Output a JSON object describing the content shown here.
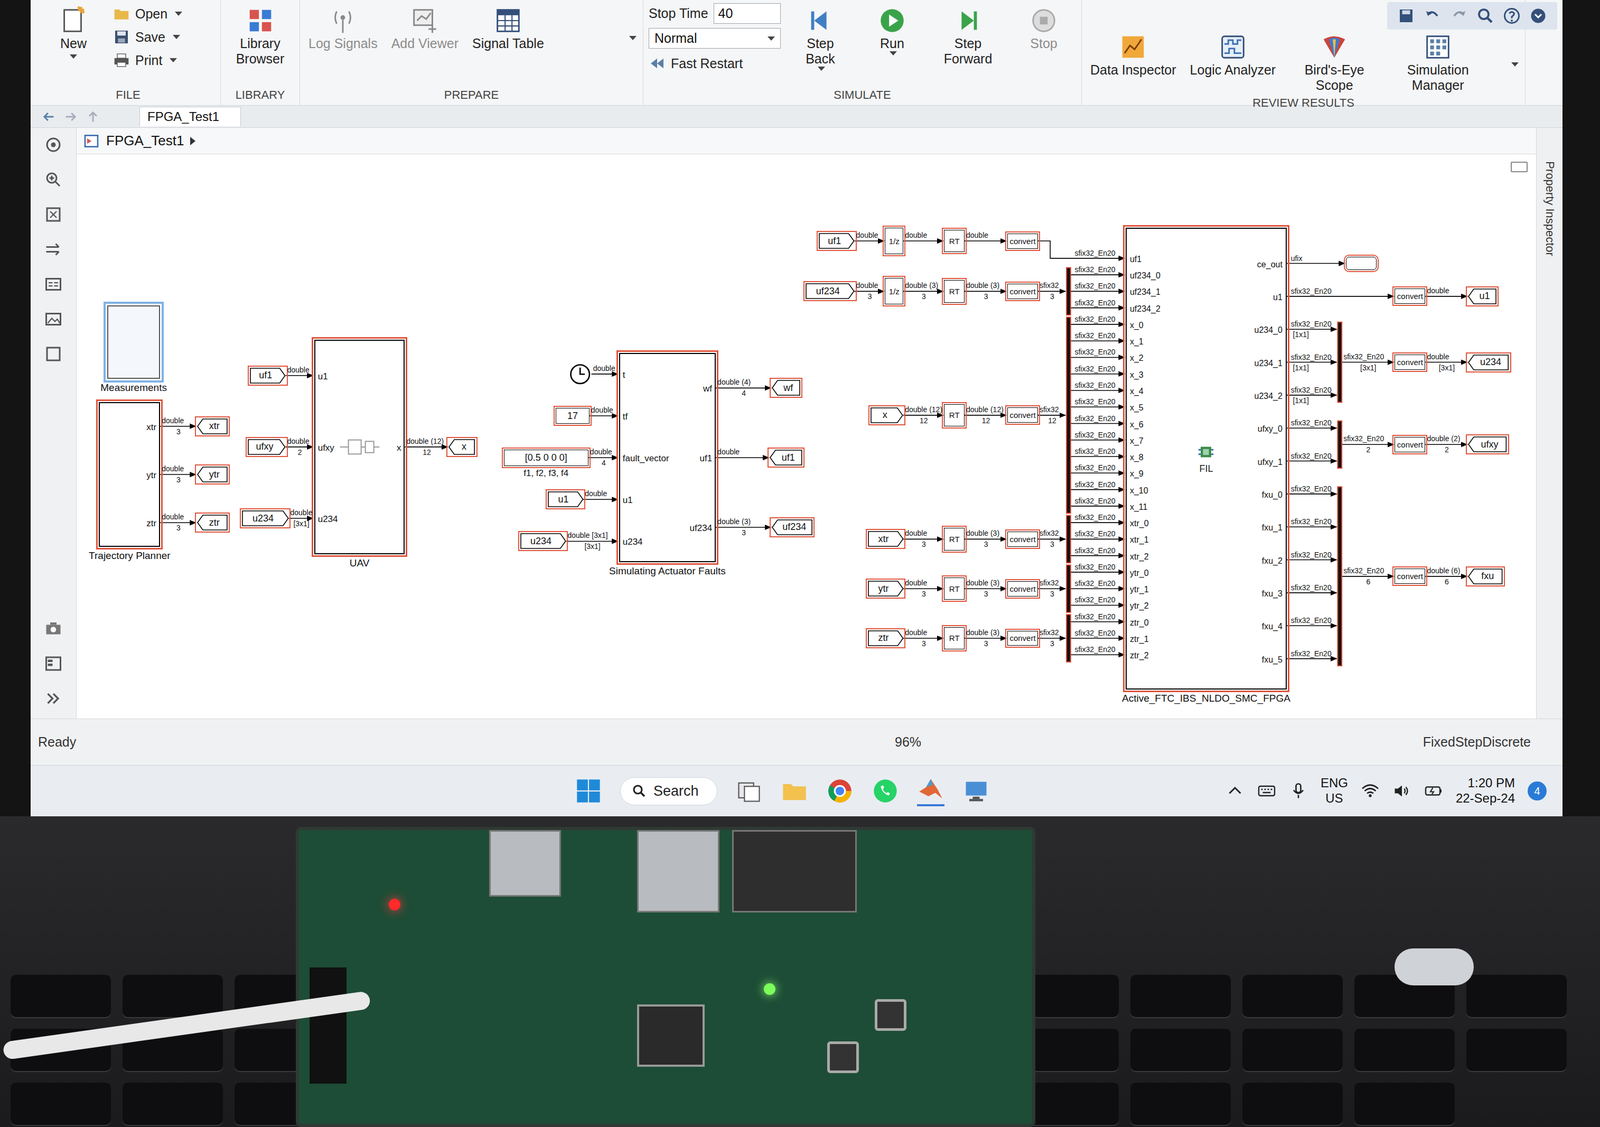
{
  "ribbon": {
    "file": {
      "group": "FILE",
      "new": "New",
      "items": [
        {
          "label": "Open"
        },
        {
          "label": "Save"
        },
        {
          "label": "Print"
        }
      ]
    },
    "library": {
      "group": "LIBRARY",
      "button": "Library Browser"
    },
    "prepare": {
      "group": "PREPARE",
      "buttons": [
        {
          "label": "Log Signals",
          "disabled": true
        },
        {
          "label": "Add Viewer",
          "disabled": true
        },
        {
          "label": "Signal Table",
          "disabled": false
        }
      ]
    },
    "simulate": {
      "group": "SIMULATE",
      "stopTimeLabel": "Stop Time",
      "stopTime": "40",
      "mode": "Normal",
      "fastRestart": "Fast Restart",
      "buttons": [
        {
          "label": "Step Back",
          "disabled": false
        },
        {
          "label": "Run",
          "disabled": false
        },
        {
          "label": "Step Forward",
          "disabled": false
        },
        {
          "label": "Stop",
          "disabled": true
        }
      ]
    },
    "review": {
      "group": "REVIEW RESULTS",
      "buttons": [
        {
          "label": "Data Inspector"
        },
        {
          "label": "Logic Analyzer"
        },
        {
          "label": "Bird's-Eye Scope"
        },
        {
          "label": "Simulation Manager"
        }
      ]
    }
  },
  "tab": "FPGA_Test1",
  "breadcrumb": "FPGA_Test1",
  "propertyInspector": "Property Inspector",
  "status": {
    "left": "Ready",
    "zoom": "96%",
    "solver": "FixedStepDiscrete"
  },
  "taskbar": {
    "search": "Search",
    "lang": "ENG",
    "region": "US",
    "time": "1:20 PM",
    "date": "22-Sep-24",
    "notifications": "4"
  },
  "diagram": {
    "blocks": [
      {
        "caption": "Measurements",
        "inputs": [],
        "outputs": [],
        "selected": true
      },
      {
        "caption": "Trajectory Planner",
        "inputs": [],
        "outputs": [
          "xtr",
          "ytr",
          "ztr"
        ],
        "selected": false
      },
      {
        "caption": "UAV",
        "inputs": [
          "u1",
          "ufxy",
          "u234"
        ],
        "outputs": [
          "x"
        ],
        "selected": false
      },
      {
        "caption": "Simulating Actuator Faults",
        "inputs": [
          "t",
          "tf",
          "fault_vector",
          "u1",
          "u234"
        ],
        "outputs": [
          "wf",
          "uf1",
          "uf234"
        ],
        "selected": false
      }
    ],
    "tags": [
      {
        "text": "xtr",
        "kind": "goto"
      },
      {
        "text": "ytr",
        "kind": "goto"
      },
      {
        "text": "ztr",
        "kind": "goto"
      },
      {
        "text": "uf1",
        "kind": "from"
      },
      {
        "text": "ufxy",
        "kind": "from"
      },
      {
        "text": "u234",
        "kind": "from"
      },
      {
        "text": "x",
        "kind": "goto"
      },
      {
        "text": "u1",
        "kind": "from"
      },
      {
        "text": "u234",
        "kind": "from"
      },
      {
        "text": "wf",
        "kind": "goto"
      },
      {
        "text": "uf1",
        "kind": "goto"
      },
      {
        "text": "uf234",
        "kind": "goto"
      },
      {
        "text": "uf1",
        "kind": "from"
      },
      {
        "text": "uf234",
        "kind": "from"
      },
      {
        "text": "x",
        "kind": "from"
      },
      {
        "text": "xtr",
        "kind": "from"
      },
      {
        "text": "ytr",
        "kind": "from"
      },
      {
        "text": "ztr",
        "kind": "from"
      },
      {
        "text": "u1",
        "kind": "goto"
      },
      {
        "text": "u234",
        "kind": "goto"
      },
      {
        "text": "ufxy",
        "kind": "goto"
      },
      {
        "text": "fxu",
        "kind": "goto"
      }
    ],
    "signals": [
      {
        "type": "double",
        "dims": "3"
      },
      {
        "type": "double",
        "dims": "3"
      },
      {
        "type": "double",
        "dims": "3"
      },
      {
        "type": "double",
        "dims": ""
      },
      {
        "type": "double",
        "dims": "2"
      },
      {
        "type": "double",
        "dims": "[3x1]"
      },
      {
        "type": "double (12)",
        "dims": "12"
      },
      {
        "type": "double",
        "dims": ""
      },
      {
        "type": "double",
        "dims": ""
      },
      {
        "type": "double",
        "dims": "4"
      },
      {
        "type": "double",
        "dims": ""
      },
      {
        "type": "double [3x1]",
        "dims": "[3x1]"
      },
      {
        "type": "double (4)",
        "dims": "4"
      },
      {
        "type": "double",
        "dims": ""
      },
      {
        "type": "double (3)",
        "dims": "3"
      },
      {
        "type": "double",
        "dims": ""
      },
      {
        "type": "double",
        "dims": ""
      },
      {
        "type": "double",
        "dims": ""
      },
      {
        "type": "double",
        "dims": "3"
      },
      {
        "type": "double (3)",
        "dims": "3"
      },
      {
        "type": "double (3)",
        "dims": "3"
      },
      {
        "type": "sfix32",
        "dims": "3"
      },
      {
        "type": "double (12)",
        "dims": "12"
      },
      {
        "type": "double (12)",
        "dims": "12"
      },
      {
        "type": "sfix32",
        "dims": "12"
      },
      {
        "type": "double",
        "dims": "3"
      },
      {
        "type": "double (3)",
        "dims": "3"
      },
      {
        "type": "sfix32",
        "dims": "3"
      },
      {
        "type": "double",
        "dims": "3"
      },
      {
        "type": "double (3)",
        "dims": "3"
      },
      {
        "type": "sfix32",
        "dims": "3"
      },
      {
        "type": "double",
        "dims": "3"
      },
      {
        "type": "double (3)",
        "dims": "3"
      },
      {
        "type": "sfix32",
        "dims": "3"
      },
      {
        "type": "double",
        "dims": ""
      },
      {
        "type": "sfix32_En20",
        "dims": "[3x1]"
      },
      {
        "type": "double",
        "dims": "[3x1]"
      },
      {
        "type": "sfix32_En20",
        "dims": "2"
      },
      {
        "type": "double (2)",
        "dims": "2"
      },
      {
        "type": "sfix32_En20",
        "dims": "6"
      },
      {
        "type": "double (6)",
        "dims": "6"
      }
    ],
    "parts": [
      {
        "kind": "clock",
        "text": "",
        "caption": ""
      },
      {
        "kind": "constant",
        "text": "17",
        "caption": ""
      },
      {
        "kind": "constant",
        "text": "[0.5 0 0 0]",
        "caption": "f1, f2, f3, f4"
      },
      {
        "kind": "delay",
        "text": "1/z",
        "caption": ""
      },
      {
        "kind": "rt",
        "text": "RT",
        "caption": ""
      },
      {
        "kind": "convert",
        "text": "convert",
        "caption": ""
      },
      {
        "kind": "delay",
        "text": "1/z",
        "caption": ""
      },
      {
        "kind": "rt",
        "text": "RT",
        "caption": ""
      },
      {
        "kind": "convert",
        "text": "convert",
        "caption": ""
      },
      {
        "kind": "rt",
        "text": "RT",
        "caption": ""
      },
      {
        "kind": "convert",
        "text": "convert",
        "caption": ""
      },
      {
        "kind": "rt",
        "text": "RT",
        "caption": ""
      },
      {
        "kind": "convert",
        "text": "convert",
        "caption": ""
      },
      {
        "kind": "rt",
        "text": "RT",
        "caption": ""
      },
      {
        "kind": "convert",
        "text": "convert",
        "caption": ""
      },
      {
        "kind": "rt",
        "text": "RT",
        "caption": ""
      },
      {
        "kind": "convert",
        "text": "convert",
        "caption": ""
      },
      {
        "kind": "terminator",
        "text": "",
        "caption": ""
      },
      {
        "kind": "convert",
        "text": "convert",
        "caption": ""
      },
      {
        "kind": "convert",
        "text": "convert",
        "caption": ""
      },
      {
        "kind": "convert",
        "text": "convert",
        "caption": ""
      },
      {
        "kind": "convert",
        "text": "convert",
        "caption": ""
      }
    ],
    "fpga": {
      "caption": "Active_FTC_IBS_NLDO_SMC_FPGA",
      "center": "FIL",
      "inputs": [
        {
          "name": "uf1",
          "signal": "sfix32_En20"
        },
        {
          "name": "uf234_0",
          "signal": "sfix32_En20"
        },
        {
          "name": "uf234_1",
          "signal": "sfix32_En20"
        },
        {
          "name": "uf234_2",
          "signal": "sfix32_En20"
        },
        {
          "name": "x_0",
          "signal": "sfix32_En20"
        },
        {
          "name": "x_1",
          "signal": "sfix32_En20"
        },
        {
          "name": "x_2",
          "signal": "sfix32_En20"
        },
        {
          "name": "x_3",
          "signal": "sfix32_En20"
        },
        {
          "name": "x_4",
          "signal": "sfix32_En20"
        },
        {
          "name": "x_5",
          "signal": "sfix32_En20"
        },
        {
          "name": "x_6",
          "signal": "sfix32_En20"
        },
        {
          "name": "x_7",
          "signal": "sfix32_En20"
        },
        {
          "name": "x_8",
          "signal": "sfix32_En20"
        },
        {
          "name": "x_9",
          "signal": "sfix32_En20"
        },
        {
          "name": "x_10",
          "signal": "sfix32_En20"
        },
        {
          "name": "x_11",
          "signal": "sfix32_En20"
        },
        {
          "name": "xtr_0",
          "signal": "sfix32_En20"
        },
        {
          "name": "xtr_1",
          "signal": "sfix32_En20"
        },
        {
          "name": "xtr_2",
          "signal": "sfix32_En20"
        },
        {
          "name": "ytr_0",
          "signal": "sfix32_En20"
        },
        {
          "name": "ytr_1",
          "signal": "sfix32_En20"
        },
        {
          "name": "ytr_2",
          "signal": "sfix32_En20"
        },
        {
          "name": "ztr_0",
          "signal": "sfix32_En20"
        },
        {
          "name": "ztr_1",
          "signal": "sfix32_En20"
        },
        {
          "name": "ztr_2",
          "signal": "sfix32_En20"
        }
      ],
      "outputs": [
        {
          "name": "ce_out",
          "signal": "ufix",
          "dims": ""
        },
        {
          "name": "u1",
          "signal": "sfix32_En20",
          "dims": ""
        },
        {
          "name": "u234_0",
          "signal": "sfix32_En20",
          "dims": "[1x1]"
        },
        {
          "name": "u234_1",
          "signal": "sfix32_En20",
          "dims": "[1x1]"
        },
        {
          "name": "u234_2",
          "signal": "sfix32_En20",
          "dims": "[1x1]"
        },
        {
          "name": "ufxy_0",
          "signal": "sfix32_En20",
          "dims": ""
        },
        {
          "name": "ufxy_1",
          "signal": "sfix32_En20",
          "dims": ""
        },
        {
          "name": "fxu_0",
          "signal": "sfix32_En20",
          "dims": ""
        },
        {
          "name": "fxu_1",
          "signal": "sfix32_En20",
          "dims": ""
        },
        {
          "name": "fxu_2",
          "signal": "sfix32_En20",
          "dims": ""
        },
        {
          "name": "fxu_3",
          "signal": "sfix32_En20",
          "dims": ""
        },
        {
          "name": "fxu_4",
          "signal": "sfix32_En20",
          "dims": ""
        },
        {
          "name": "fxu_5",
          "signal": "sfix32_En20",
          "dims": ""
        }
      ]
    }
  }
}
